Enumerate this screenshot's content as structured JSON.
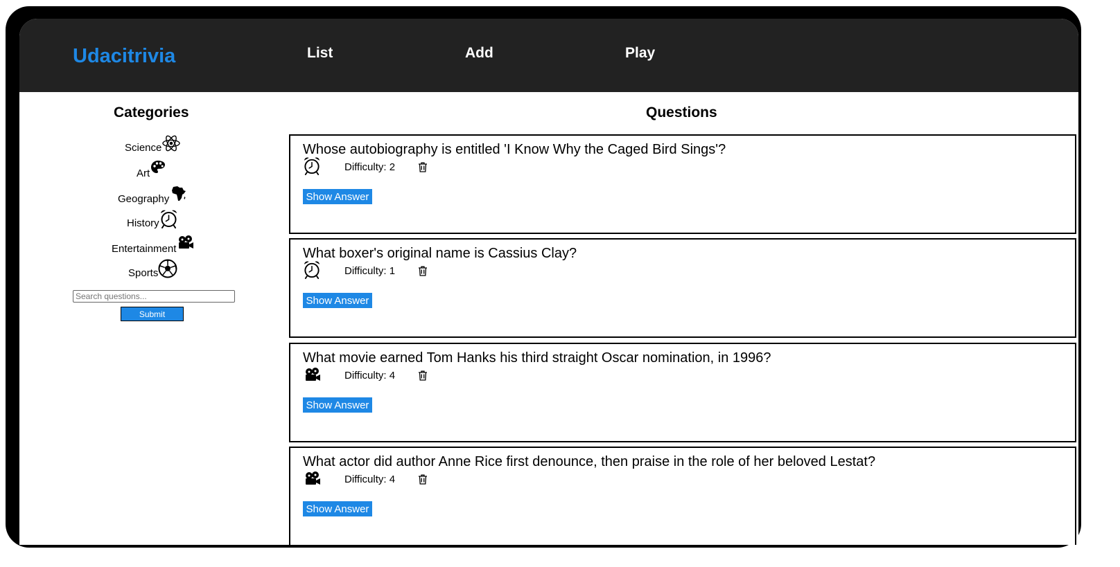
{
  "header": {
    "logo": "Udacitrivia",
    "nav": [
      "List",
      "Add",
      "Play"
    ]
  },
  "sidebar": {
    "title": "Categories",
    "categories": [
      {
        "label": "Science",
        "icon": "atom-icon"
      },
      {
        "label": "Art",
        "icon": "palette-icon"
      },
      {
        "label": "Geography",
        "icon": "africa-map-icon"
      },
      {
        "label": "History",
        "icon": "alarm-clock-icon"
      },
      {
        "label": "Entertainment",
        "icon": "movie-camera-icon"
      },
      {
        "label": "Sports",
        "icon": "soccer-ball-icon"
      }
    ],
    "search_placeholder": "Search questions...",
    "search_value": "",
    "submit_label": "Submit"
  },
  "main": {
    "title": "Questions",
    "questions": [
      {
        "text": "Whose autobiography is entitled 'I Know Why the Caged Bird Sings'?",
        "difficulty": "Difficulty: 2",
        "icon": "alarm-clock-icon",
        "button": "Show Answer"
      },
      {
        "text": "What boxer's original name is Cassius Clay?",
        "difficulty": "Difficulty: 1",
        "icon": "alarm-clock-icon",
        "button": "Show Answer"
      },
      {
        "text": "What movie earned Tom Hanks his third straight Oscar nomination, in 1996?",
        "difficulty": "Difficulty: 4",
        "icon": "movie-camera-icon",
        "button": "Show Answer"
      },
      {
        "text": "What actor did author Anne Rice first denounce, then praise in the role of her beloved Lestat?",
        "difficulty": "Difficulty: 4",
        "icon": "movie-camera-icon",
        "button": "Show Answer"
      }
    ]
  },
  "colors": {
    "header_bg": "#222222",
    "accent": "#1e88e5",
    "frame": "#000000"
  }
}
